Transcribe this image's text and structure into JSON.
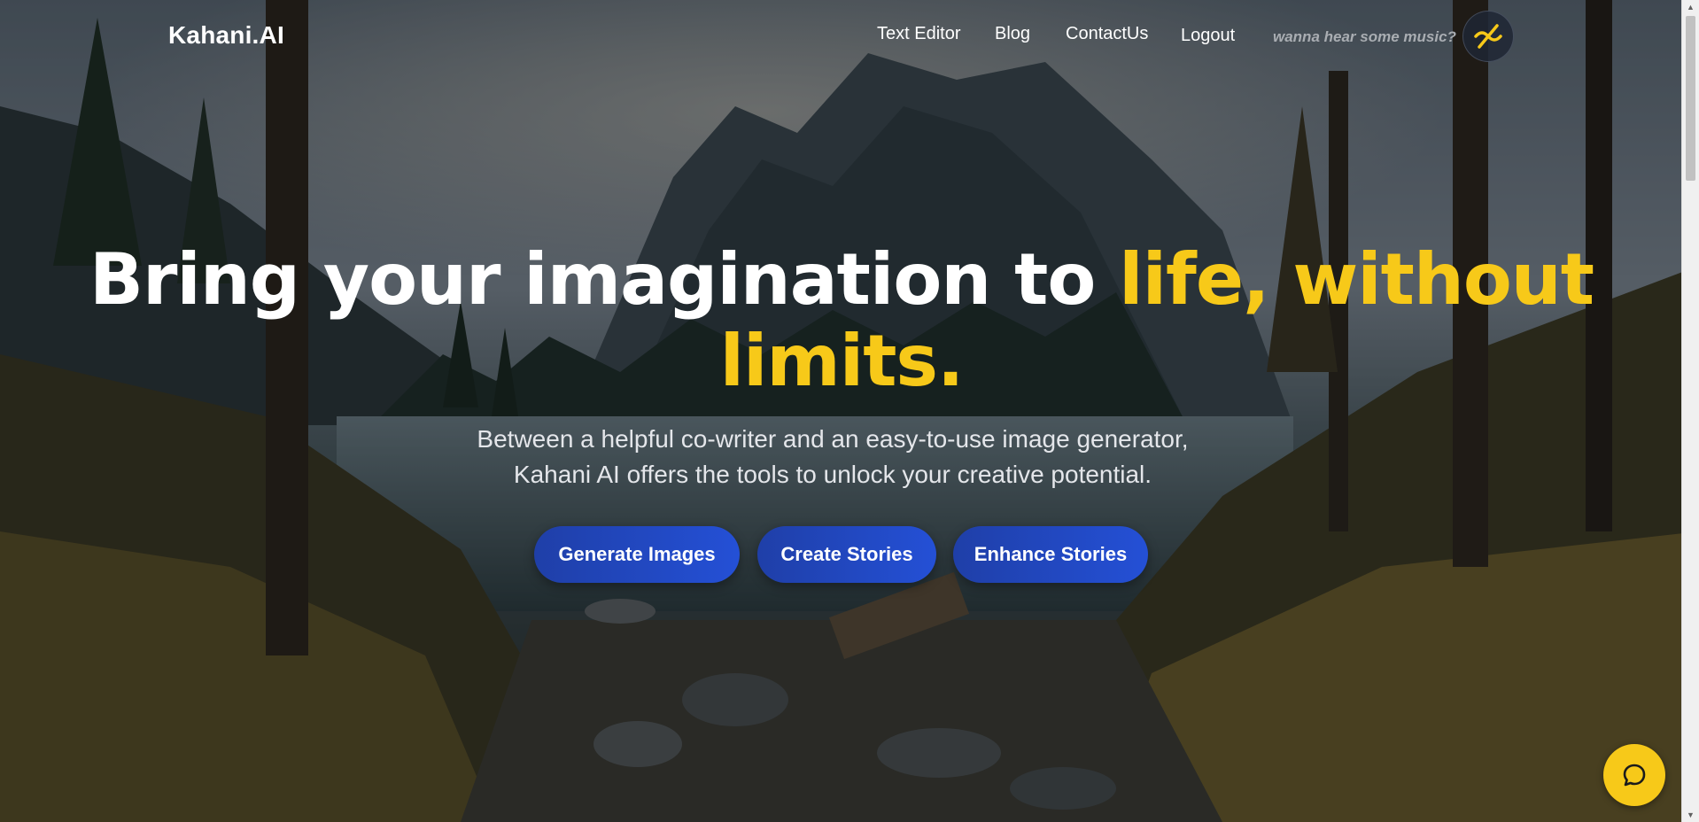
{
  "brand": {
    "logo": "Kahani.AI"
  },
  "nav": {
    "links": [
      "Text Editor",
      "Blog",
      "ContactUs",
      "Logout"
    ],
    "music_hint": "wanna hear some music?",
    "music_icon": "music-muted-icon"
  },
  "hero": {
    "title_white": "Bring your imagination to ",
    "title_accent": "life, without limits.",
    "subtitle_line1": "Between a helpful co-writer and an easy-to-use image generator,",
    "subtitle_line2": "Kahani AI offers the tools to unlock your creative potential.",
    "buttons": [
      "Generate Images",
      "Create Stories",
      "Enhance Stories"
    ]
  },
  "chat": {
    "icon": "chat-bubble-icon"
  },
  "colors": {
    "accent": "#f7c919",
    "button": "#2450d6",
    "text": "#ffffff"
  }
}
